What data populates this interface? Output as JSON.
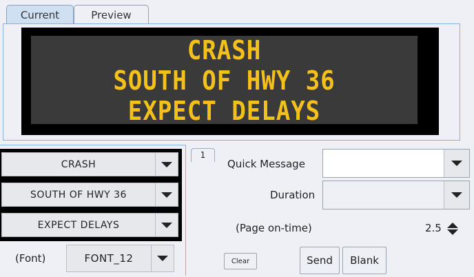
{
  "tabs": [
    {
      "label": "Current"
    },
    {
      "label": "Preview"
    }
  ],
  "sign": {
    "lines": [
      "CRASH",
      "SOUTH OF HWY 36",
      "EXPECT DELAYS"
    ],
    "text_color": "#f4c01a",
    "background_color": "#3a3a3a"
  },
  "compose": {
    "lines": [
      "CRASH",
      "SOUTH OF HWY 36",
      "EXPECT DELAYS"
    ],
    "font_label": "(Font)",
    "font_value": "FONT_12"
  },
  "page_tab": "1",
  "quick_message": {
    "label": "Quick Message",
    "value": ""
  },
  "duration": {
    "label": "Duration",
    "value": ""
  },
  "page_on_time": {
    "label": "(Page on-time)",
    "value": "2.5"
  },
  "buttons": {
    "clear": "Clear",
    "send": "Send",
    "blank": "Blank"
  }
}
